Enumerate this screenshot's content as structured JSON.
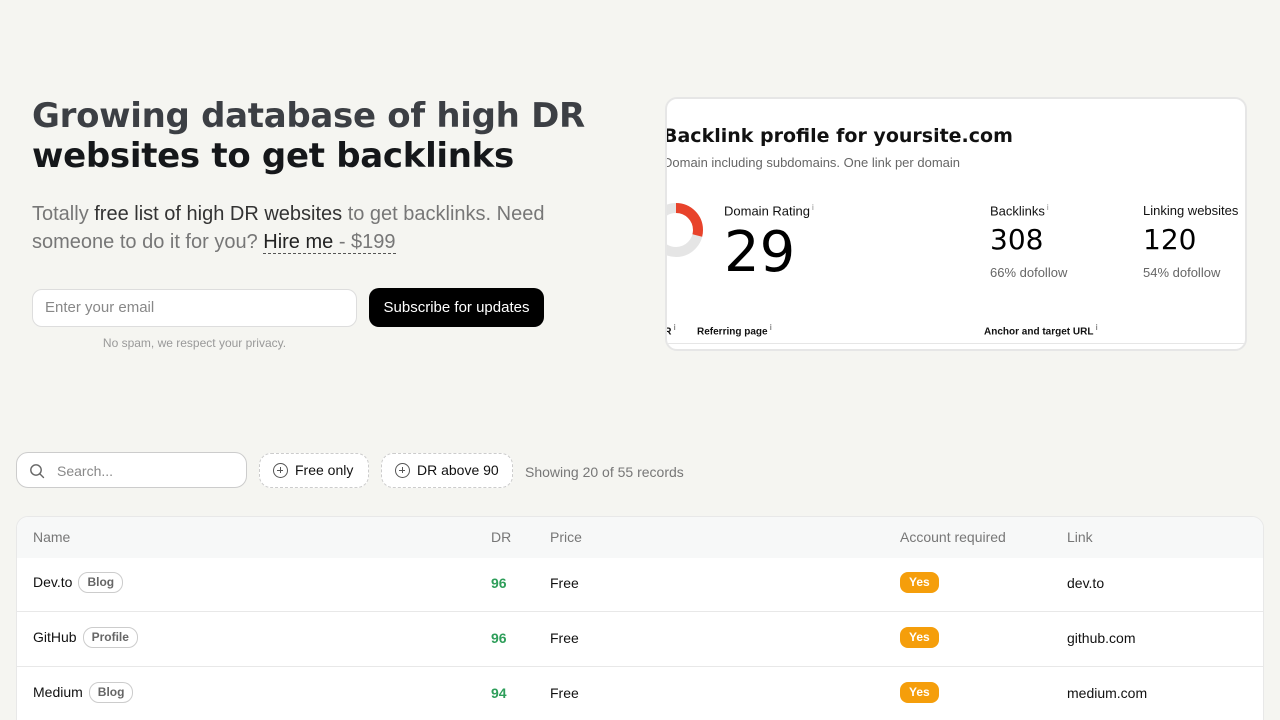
{
  "hero": {
    "title_muted": "Growing database of high DR",
    "title_dark": "websites to get backlinks",
    "sub_part1": "Totally ",
    "sub_part2": "free list of high DR websites",
    "sub_part3": " to get backlinks. Need someone to do it for you? ",
    "hire_label": "Hire me",
    "hire_price": " - $199"
  },
  "signup": {
    "email_placeholder": "Enter your email",
    "subscribe_label": "Subscribe for updates",
    "privacy_note": "No spam, we respect your privacy."
  },
  "preview_card": {
    "title": "Backlink profile for yoursite.com",
    "description": "Domain including subdomains. One link per domain",
    "domain_rating_label": "Domain Rating",
    "domain_rating_value": "29",
    "domain_rating_fraction": 0.29,
    "backlinks_label": "Backlinks",
    "backlinks_value": "308",
    "backlinks_sub": "66% dofollow",
    "linking_label": "Linking websites",
    "linking_value": "120",
    "linking_sub": "54% dofollow",
    "col_dr": "DR",
    "col_referring": "Referring page",
    "col_anchor": "Anchor and target URL",
    "info_glyph": "i",
    "colors": {
      "donut_fill": "#e8432b",
      "donut_track": "#e5e5e5"
    }
  },
  "filters": {
    "search_placeholder": "Search...",
    "chip_free": "Free only",
    "chip_dr": "DR above 90",
    "showing_text": "Showing 20 of 55 records"
  },
  "table": {
    "headers": {
      "name": "Name",
      "dr": "DR",
      "price": "Price",
      "account": "Account required",
      "link": "Link"
    },
    "rows": [
      {
        "name": "Dev.to",
        "tag": "Blog",
        "dr": "96",
        "price": "Free",
        "account": "Yes",
        "link": "dev.to"
      },
      {
        "name": "GitHub",
        "tag": "Profile",
        "dr": "96",
        "price": "Free",
        "account": "Yes",
        "link": "github.com"
      },
      {
        "name": "Medium",
        "tag": "Blog",
        "dr": "94",
        "price": "Free",
        "account": "Yes",
        "link": "medium.com"
      }
    ]
  },
  "colors": {
    "dr_green": "#2e9e5a",
    "yes_badge": "#f59e0b"
  }
}
